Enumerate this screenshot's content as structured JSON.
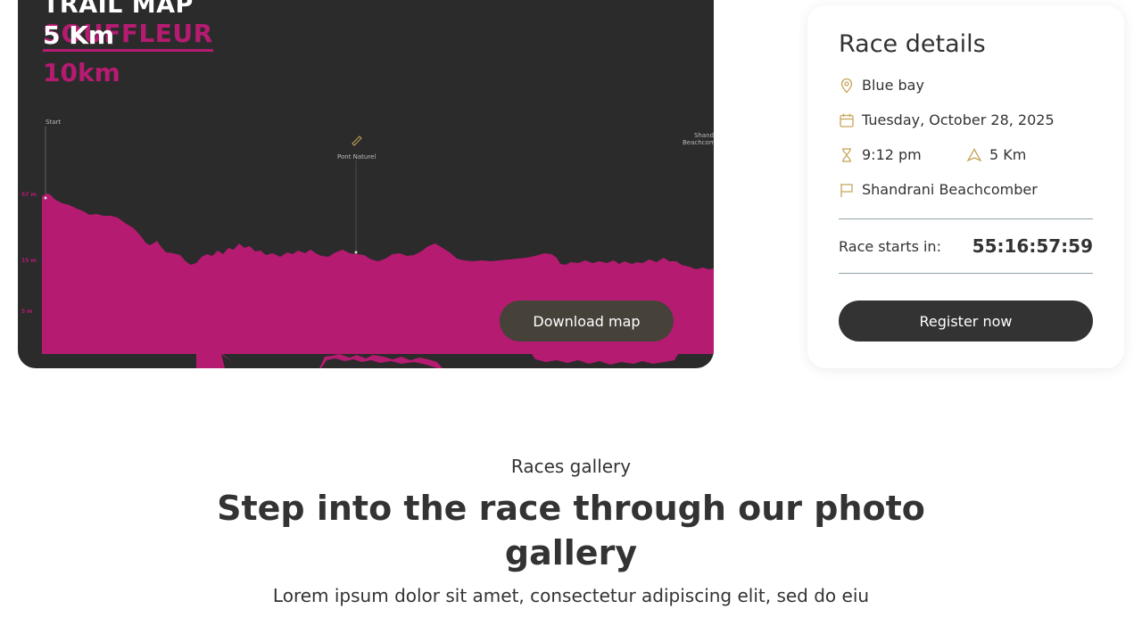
{
  "trail_map": {
    "title": "TRAIL MAP",
    "subtitle": "SOUFFLEUR",
    "distance_overlay": "5 Km",
    "distance_big": "10km",
    "labels": {
      "start": "Start",
      "midpoint": "Pont Naturel",
      "end_line1": "Shandrani",
      "end_line2": "Beachcomber"
    },
    "elevation_ticks": [
      "57 m",
      "15 m",
      "5 m"
    ],
    "profile_color": "#b51b70",
    "download_label": "Download map"
  },
  "race_details": {
    "title": "Race details",
    "location": "Blue bay",
    "date": "Tuesday, October 28, 2025",
    "time": "9:12 pm",
    "distance": "5 Km",
    "finish": "Shandrani Beachcomber",
    "countdown_label": "Race starts in:",
    "countdown_value": "55:16:57:59",
    "register_label": "Register now",
    "icon_color": "#c5a55a"
  },
  "gallery": {
    "eyebrow": "Races gallery",
    "heading": "Step into the race through our photo gallery",
    "description": "Lorem ipsum dolor sit amet, consectetur adipiscing elit, sed do eiu"
  }
}
